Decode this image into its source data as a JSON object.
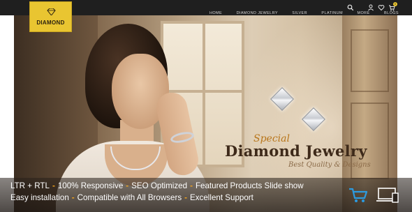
{
  "logo": {
    "text": "DIAMOND"
  },
  "nav": {
    "items": [
      "HOME",
      "DIAMOND JEWELRY",
      "SILVER",
      "PLATINUM",
      "MORE",
      "BLOGS"
    ]
  },
  "header_tools": {
    "search_icon": "search-icon",
    "user_icon": "user-icon",
    "wishlist_icon": "heart-icon",
    "cart_icon": "cart-icon",
    "cart_count": "0"
  },
  "hero": {
    "special": "Special",
    "headline": "Diamond Jewelry",
    "tagline": "Best Quality & Designs"
  },
  "features": {
    "line1": [
      "LTR + RTL",
      "100% Responsive",
      "SEO Optimized",
      "Featured Products Slide show"
    ],
    "line2": [
      "Easy installation",
      "Compatible with All Browsers",
      "Excellent Support"
    ],
    "separator": "-"
  },
  "colors": {
    "header_bg": "#1f1f1f",
    "logo_bg": "#e9c531",
    "accent_orange": "#f0a21c",
    "headline": "#3e2a1a",
    "special": "#b8761b",
    "cart_blue": "#2c9be0"
  }
}
